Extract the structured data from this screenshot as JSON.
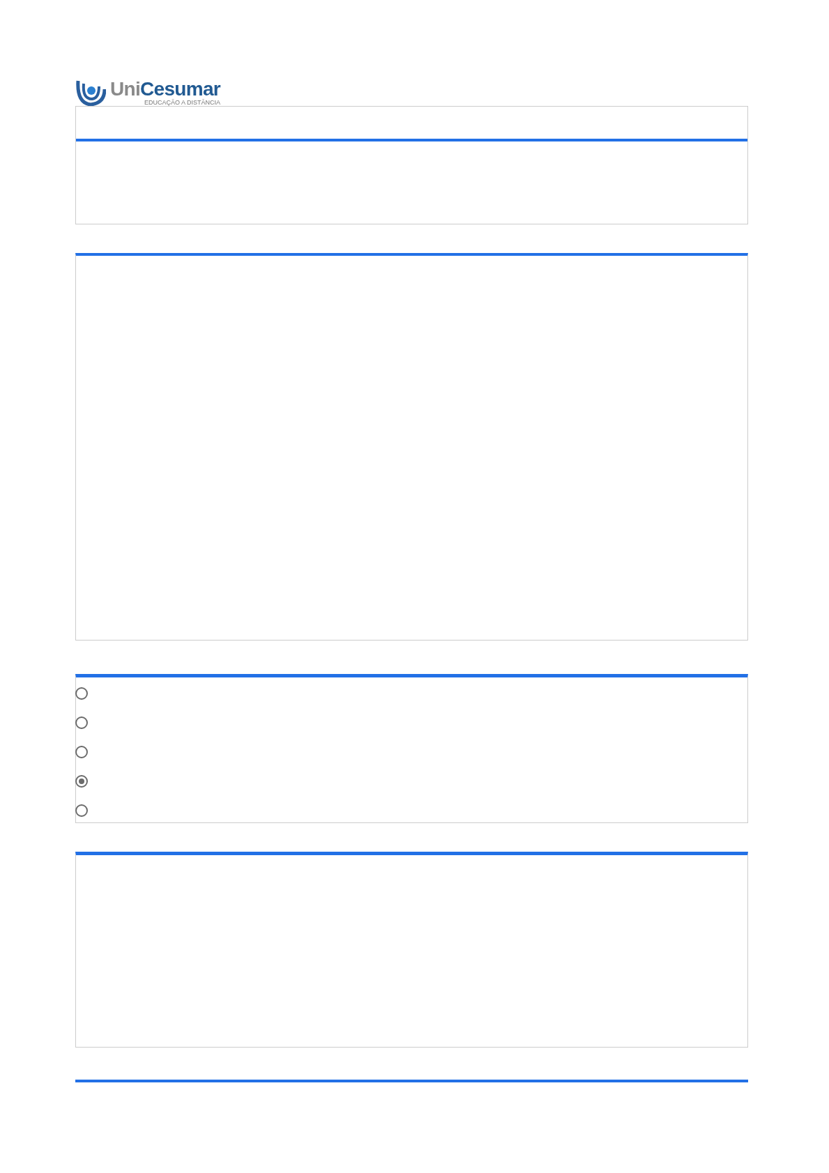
{
  "logo": {
    "wordmark_first": "Uni",
    "wordmark_second": "Cesumar",
    "tagline": "EDUCAÇÃO A DISTÂNCIA"
  },
  "options": [
    {
      "selected": false
    },
    {
      "selected": false
    },
    {
      "selected": false
    },
    {
      "selected": true
    },
    {
      "selected": false
    }
  ]
}
